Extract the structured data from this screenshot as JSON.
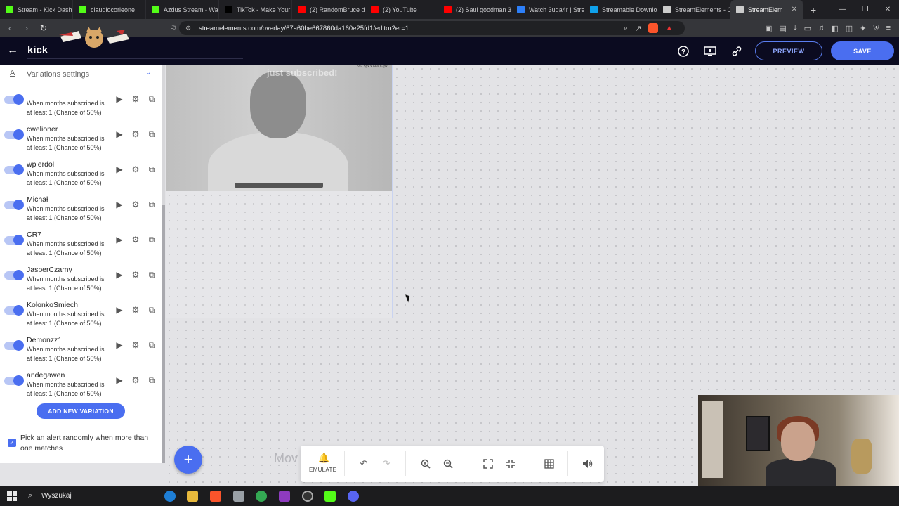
{
  "browser": {
    "tabs": [
      {
        "label": "Stream - Kick Dashb",
        "color": "#53fc18"
      },
      {
        "label": "claudiocorleone",
        "color": "#53fc18"
      },
      {
        "label": "Azdus Stream - Wat",
        "color": "#53fc18"
      },
      {
        "label": "TikTok - Make Your",
        "color": "#000000"
      },
      {
        "label": "(2) RandomBruce d",
        "color": "#ff0000"
      },
      {
        "label": "(2) YouTube",
        "color": "#ff0000"
      },
      {
        "label": "(2) Saul goodman 3",
        "color": "#ff0000"
      },
      {
        "label": "Watch 3uqa4r | Stre",
        "color": "#2d7ff9"
      },
      {
        "label": "Streamable Downlo",
        "color": "#0fa0ea"
      },
      {
        "label": "StreamElements - O",
        "color": "#cccccc"
      },
      {
        "label": "StreamElem",
        "color": "#cccccc",
        "active": true
      }
    ],
    "url": "streamelements.com/overlay/67a60be667860da160e25fd1/editor?er=1"
  },
  "header": {
    "overlay_name": "kick",
    "preview_label": "PREVIEW",
    "save_label": "SAVE"
  },
  "canvas": {
    "ghost_text": "just subscribed!",
    "size_label": "597.5px x 669.87px",
    "move_hint": "Mov"
  },
  "panel": {
    "section_title": "Variations settings",
    "variations": [
      {
        "name": "",
        "desc": "When months subscribed is at least 1 (Chance of 50%)"
      },
      {
        "name": "cwelioner",
        "desc": "When months subscribed is at least 1 (Chance of 50%)"
      },
      {
        "name": "wpierdol",
        "desc": "When months subscribed is at least 1 (Chance of 50%)"
      },
      {
        "name": "Michał",
        "desc": "When months subscribed is at least 1 (Chance of 50%)"
      },
      {
        "name": "CR7",
        "desc": "When months subscribed is at least 1 (Chance of 50%)"
      },
      {
        "name": "JasperCzarny",
        "desc": "When months subscribed is at least 1 (Chance of 50%)"
      },
      {
        "name": "KolonkoSmiech",
        "desc": "When months subscribed is at least 1 (Chance of 50%)"
      },
      {
        "name": "Demonzz1",
        "desc": "When months subscribed is at least 1 (Chance of 50%)"
      },
      {
        "name": "andegawen",
        "desc": "When months subscribed is at least 1 (Chance of 50%)"
      }
    ],
    "add_variation_label": "ADD NEW VARIATION",
    "random_label": "Pick an alert randomly when more than one matches",
    "random_checked": true
  },
  "toolbar": {
    "emulate_label": "EMULATE"
  },
  "taskbar": {
    "search_text": "Wyszukaj"
  },
  "colors": {
    "accent": "#4a6ef0",
    "header_bg": "#0b0b20"
  }
}
